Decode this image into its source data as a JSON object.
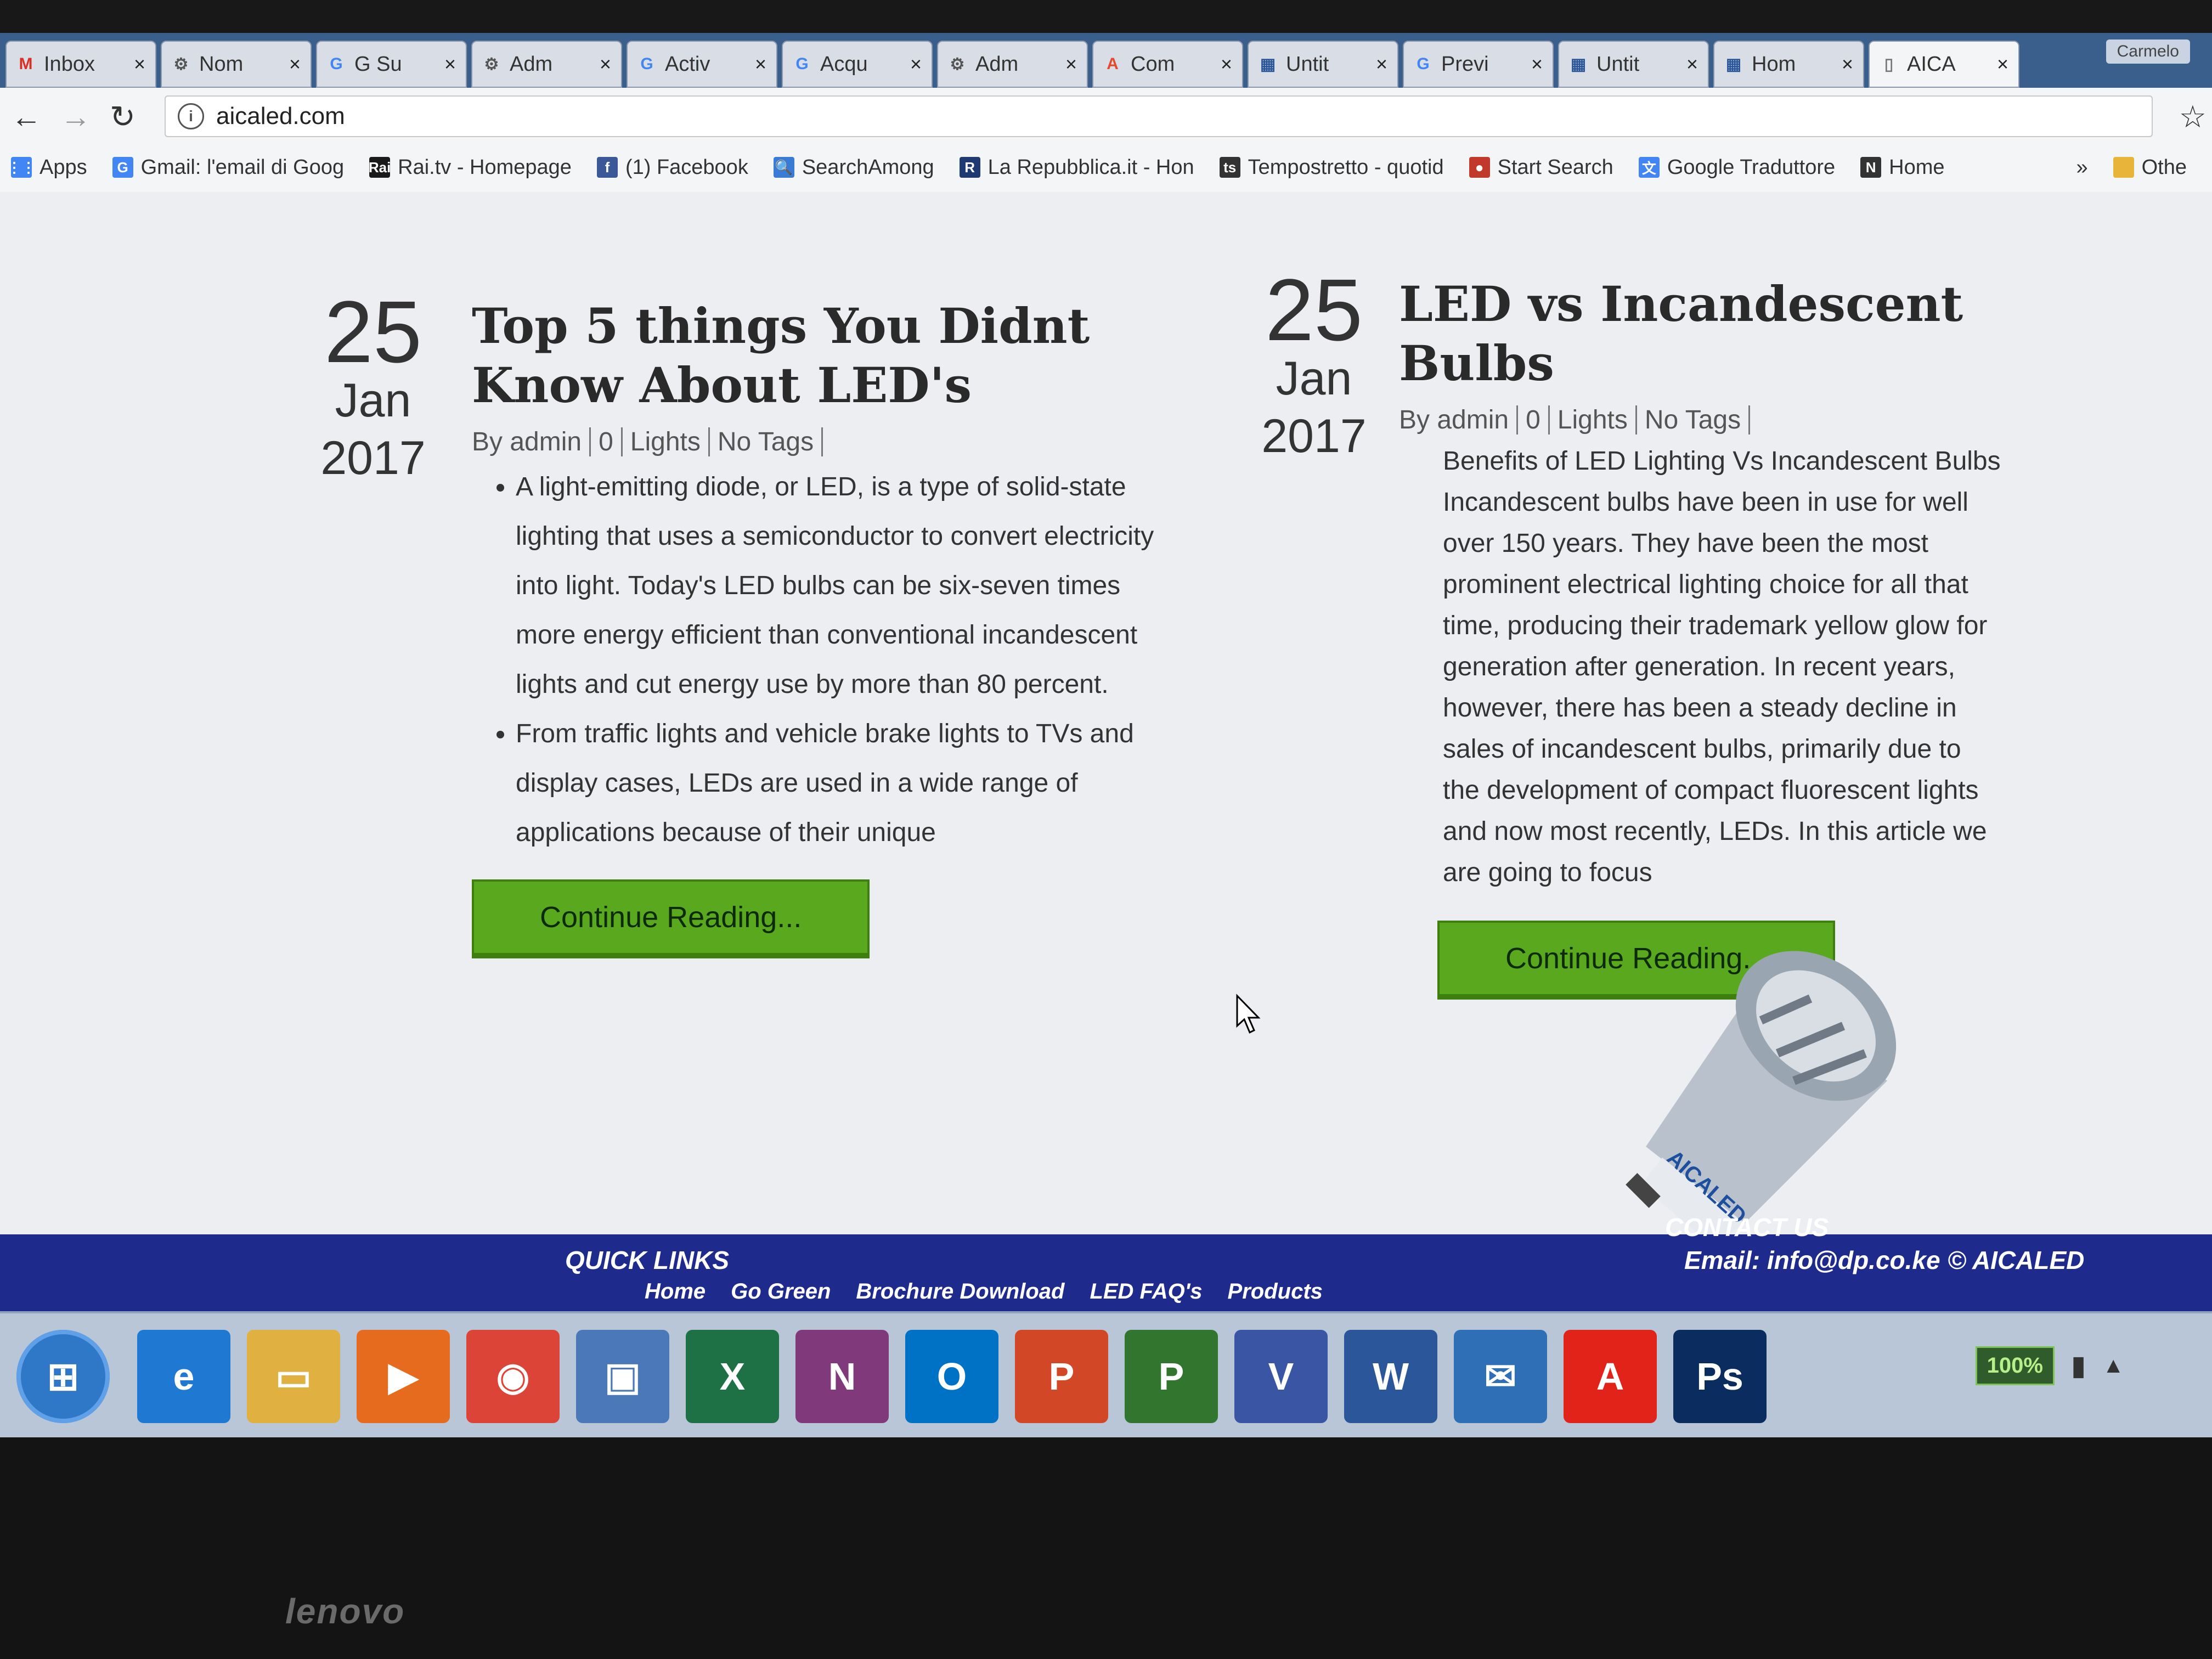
{
  "browser": {
    "tabs": [
      {
        "title": "Inbox",
        "icon": "M",
        "color": "#d93025"
      },
      {
        "title": "Nom",
        "icon": "⚙",
        "color": "#555"
      },
      {
        "title": "G Su",
        "icon": "G",
        "color": "#4285f4"
      },
      {
        "title": "Adm",
        "icon": "⚙",
        "color": "#555"
      },
      {
        "title": "Activ",
        "icon": "G",
        "color": "#4285f4"
      },
      {
        "title": "Acqu",
        "icon": "G",
        "color": "#4285f4"
      },
      {
        "title": "Adm",
        "icon": "⚙",
        "color": "#555"
      },
      {
        "title": "Com",
        "icon": "A",
        "color": "#e34b2c"
      },
      {
        "title": "Untit",
        "icon": "▦",
        "color": "#2b579a"
      },
      {
        "title": "Previ",
        "icon": "G",
        "color": "#4285f4"
      },
      {
        "title": "Untit",
        "icon": "▦",
        "color": "#2b579a"
      },
      {
        "title": "Hom",
        "icon": "▦",
        "color": "#2b579a"
      },
      {
        "title": "AICA",
        "icon": "▯",
        "color": "#777"
      }
    ],
    "profile": "Carmelo",
    "url": "aicaled.com",
    "bookmarks": [
      {
        "label": "Apps",
        "icon": "⋮⋮",
        "color": "#4285f4"
      },
      {
        "label": "Gmail: l'email di Goog",
        "icon": "G",
        "color": "#4285f4"
      },
      {
        "label": "Rai.tv - Homepage",
        "icon": "Rai",
        "color": "#1a1a1a"
      },
      {
        "label": "(1) Facebook",
        "icon": "f",
        "color": "#3b5998"
      },
      {
        "label": "SearchAmong",
        "icon": "🔍",
        "color": "#3a7bd5"
      },
      {
        "label": "La Repubblica.it - Hon",
        "icon": "R",
        "color": "#1f3a73"
      },
      {
        "label": "Tempostretto - quotid",
        "icon": "ts",
        "color": "#333"
      },
      {
        "label": "Start Search",
        "icon": "●",
        "color": "#c0392b"
      },
      {
        "label": "Google Traduttore",
        "icon": "文",
        "color": "#4285f4"
      },
      {
        "label": "Home",
        "icon": "N",
        "color": "#333"
      }
    ],
    "bookmarks_more": "»",
    "bookmarks_other": "Othe"
  },
  "posts": [
    {
      "day": "25",
      "month": "Jan",
      "year": "2017",
      "title": "Top 5 things You Didnt Know About LED's",
      "author": "By admin",
      "comments": "0",
      "category": "Lights",
      "tags": "No Tags",
      "bullets": [
        "A light-emitting diode, or LED, is a type of solid-state lighting that uses a semiconductor to convert electricity into light. Today's LED bulbs can be six-seven times more energy efficient than conventional incandescent lights and cut energy use by more than 80 percent.",
        "From traffic lights and vehicle brake lights to TVs and display cases, LEDs are used in a wide range of applications because of their unique"
      ],
      "button": "Continue Reading..."
    },
    {
      "day": "25",
      "month": "Jan",
      "year": "2017",
      "title": "LED vs Incandescent Bulbs",
      "author": "By admin",
      "comments": "0",
      "category": "Lights",
      "tags": "No Tags",
      "body": "Benefits of LED Lighting Vs Incandescent Bulbs Incandescent bulbs have been in use for well over 150 years. They have been the most prominent electrical lighting choice for all that time, producing their trademark yellow glow for generation after generation. In recent years, however, there has been a steady decline in sales of incandescent bulbs, primarily due to the development of compact fluorescent lights and now most recently, LEDs. In this article we are going to focus",
      "button": "Continue Reading..."
    }
  ],
  "product_label": "AICALED",
  "footer": {
    "quick_links_title": "QUICK LINKS",
    "quick_links": [
      "Home",
      "Go Green",
      "Brochure Download",
      "LED FAQ's",
      "Products"
    ],
    "contact_title": "CONTACT US",
    "email": "Email: info@dp.co.ke",
    "copyright": "© AICALED"
  },
  "taskbar": {
    "apps": [
      {
        "name": "internet-explorer-icon",
        "glyph": "e",
        "color": "#1f78d1"
      },
      {
        "name": "file-explorer-icon",
        "glyph": "▭",
        "color": "#e0b040"
      },
      {
        "name": "media-player-icon",
        "glyph": "▶",
        "color": "#e66b1f"
      },
      {
        "name": "chrome-icon",
        "glyph": "◉",
        "color": "#db4437"
      },
      {
        "name": "generic-app-icon",
        "glyph": "▣",
        "color": "#4a78b8"
      },
      {
        "name": "excel-icon",
        "glyph": "X",
        "color": "#1e7145"
      },
      {
        "name": "onenote-icon",
        "glyph": "N",
        "color": "#80397b"
      },
      {
        "name": "outlook-icon",
        "glyph": "O",
        "color": "#0072c6"
      },
      {
        "name": "powerpoint-icon",
        "glyph": "P",
        "color": "#d24726"
      },
      {
        "name": "project-icon",
        "glyph": "P",
        "color": "#31752f"
      },
      {
        "name": "visio-icon",
        "glyph": "V",
        "color": "#3955a3"
      },
      {
        "name": "word-icon",
        "glyph": "W",
        "color": "#2b579a"
      },
      {
        "name": "thunderbird-icon",
        "glyph": "✉",
        "color": "#2f6fb5"
      },
      {
        "name": "acrobat-icon",
        "glyph": "A",
        "color": "#e2231a"
      },
      {
        "name": "photoshop-icon",
        "glyph": "Ps",
        "color": "#0a2c5e"
      }
    ],
    "battery": "100%"
  },
  "laptop_brand": "lenovo"
}
